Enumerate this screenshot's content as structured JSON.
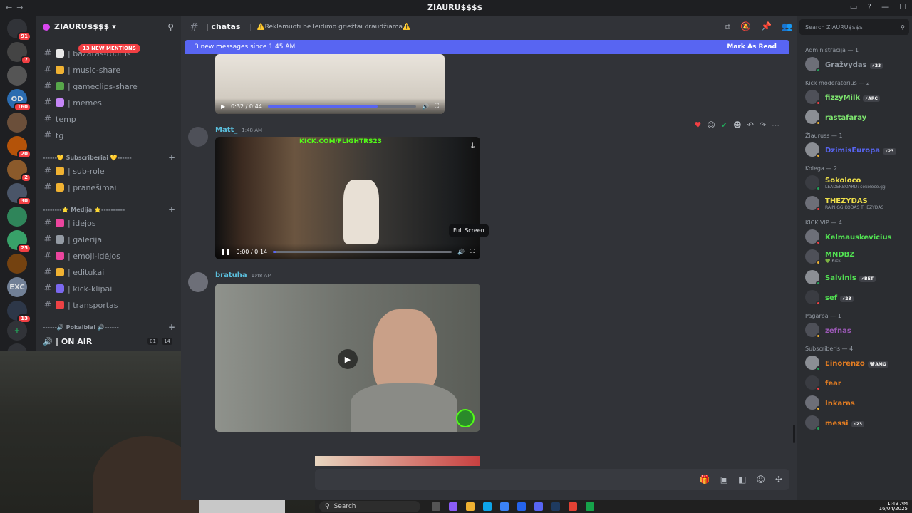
{
  "titlebar": {
    "title": "ZIAURU$$$$"
  },
  "server": {
    "name": "ZIAURU$$$$",
    "mentions_pill": "13 NEW MENTIONS"
  },
  "guild_badges": [
    "91",
    "7",
    "",
    "160",
    "",
    "20",
    "2",
    "30",
    "",
    "25",
    "",
    "",
    "13"
  ],
  "guild_labels": [
    "",
    "",
    "",
    "OD",
    "",
    "",
    "",
    "",
    "",
    "",
    "",
    "EXC",
    ""
  ],
  "channels": [
    {
      "name": "| bazaras-rooms",
      "color": "#e8e8e8"
    },
    {
      "name": "| music-share",
      "color": "#f0b232"
    },
    {
      "name": "| gameclips-share",
      "color": "#57a64a"
    },
    {
      "name": "| memes",
      "color": "#c586f7"
    },
    {
      "name": "temp",
      "color": ""
    },
    {
      "name": "tg",
      "color": ""
    }
  ],
  "cat_subs": "------💛 Subscriberiai 💛------",
  "channels_subs": [
    {
      "name": "| sub-role",
      "color": "#f0b232"
    },
    {
      "name": "| pranešimai",
      "color": "#f0b232"
    }
  ],
  "cat_media": "--------⭐ Medija ⭐----------",
  "channels_media": [
    {
      "name": "| idejos",
      "color": "#eb459e"
    },
    {
      "name": "| galerija",
      "color": "#949ba4"
    },
    {
      "name": "| emoji-idėjos",
      "color": "#eb459e"
    },
    {
      "name": "| editukai",
      "color": "#f0b232"
    },
    {
      "name": "| kick-klipai",
      "color": "#7b68ee"
    },
    {
      "name": "| transportas",
      "color": "#ed4245"
    }
  ],
  "cat_voice": "------🔊 Pokalbiai 🔊------",
  "voice": {
    "name": "| ON AIR",
    "count1": "01",
    "count2": "14"
  },
  "channel_header": {
    "name": "| chatas",
    "topic": "⚠️Reklamuoti be leidimo griežtai draudžiama⚠️"
  },
  "new_messages": {
    "text": "3 new messages since 1:45 AM",
    "action": "Mark As Read"
  },
  "video1": {
    "time": "0:32 / 0:44",
    "progress": 0.74
  },
  "message2": {
    "author": "Matt_",
    "timestamp": "1:48 AM",
    "video_overlay": "KICK.COM/FLIGHTRS23",
    "time": "0:00 / 0:14",
    "progress": 0.02,
    "tooltip": "Full Screen"
  },
  "message3": {
    "author": "bratuha",
    "timestamp": "1:48 AM"
  },
  "member_search": "Search ZIAURU$$$$",
  "roles": [
    {
      "label": "Administracija — 1",
      "members": [
        {
          "name": "Gražvydas",
          "tag": "⚡23",
          "color": "#949ba4",
          "sub": ""
        }
      ]
    },
    {
      "label": "Kick moderatorius — 2",
      "members": [
        {
          "name": "fizzyMilk",
          "tag": "⚡ARC",
          "color": "#7ee66f",
          "sub": ""
        },
        {
          "name": "rastafaray",
          "tag": "",
          "color": "#7ee66f",
          "sub": ""
        }
      ]
    },
    {
      "label": "Žiauruss — 1",
      "members": [
        {
          "name": "DzimisEuropa",
          "tag": "⚡23",
          "color": "#5865f2",
          "sub": ""
        }
      ]
    },
    {
      "label": "Kolega — 2",
      "members": [
        {
          "name": "Sokoloco",
          "tag": "",
          "color": "#f0e14a",
          "sub": "LEADERBOARD: sokoloco.gg"
        },
        {
          "name": "THEZYDAS",
          "tag": "",
          "color": "#f0e14a",
          "sub": "RAIN.GG KODAS THEZYDAS"
        }
      ]
    },
    {
      "label": "KICK VIP — 4",
      "members": [
        {
          "name": "Kelmauskevicius",
          "tag": "",
          "color": "#52e252",
          "sub": ""
        },
        {
          "name": "MNDBZ",
          "tag": "",
          "color": "#52e252",
          "sub": "💚 Kick"
        },
        {
          "name": "Salvinis",
          "tag": "⚡BET",
          "color": "#52e252",
          "sub": ""
        },
        {
          "name": "sef",
          "tag": "⚡23",
          "color": "#52e252",
          "sub": ""
        }
      ]
    },
    {
      "label": "Pagarba — 1",
      "members": [
        {
          "name": "zefnas",
          "tag": "",
          "color": "#9b59b6",
          "sub": ""
        }
      ]
    },
    {
      "label": "Subscriberis — 4",
      "members": [
        {
          "name": "Einorenzo",
          "tag": "🤍AMG",
          "color": "#e67e22",
          "sub": ""
        },
        {
          "name": "fear",
          "tag": "",
          "color": "#e67e22",
          "sub": ""
        },
        {
          "name": "Inkaras",
          "tag": "",
          "color": "#e67e22",
          "sub": ""
        },
        {
          "name": "messi",
          "tag": "⚡23",
          "color": "#e67e22",
          "sub": ""
        }
      ]
    }
  ],
  "taskbar": {
    "search": "Search",
    "time": "1:49 AM",
    "date": "16/04/2025"
  },
  "colors": {
    "accent": "#5865f2",
    "danger": "#f23f43",
    "bg_main": "#313338",
    "bg_side": "#2b2d31"
  }
}
